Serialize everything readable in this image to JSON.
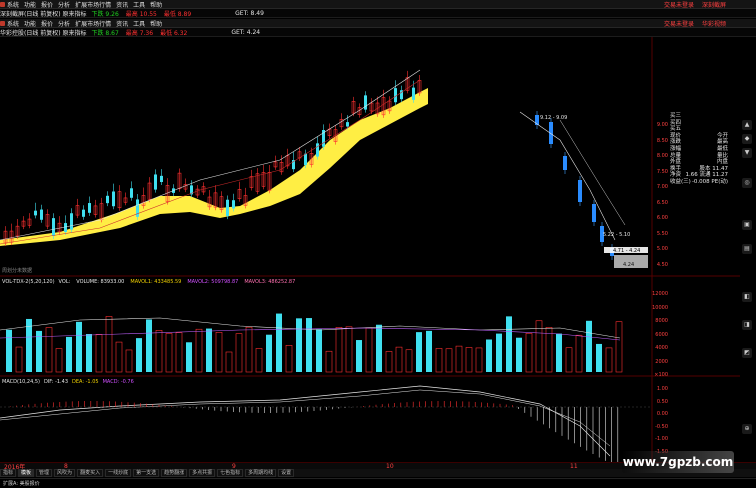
{
  "menu1": {
    "items": [
      "系统",
      "功能",
      "报价",
      "分析",
      "扩展市场行情",
      "资讯",
      "工具",
      "帮助"
    ],
    "right_links": [
      "交易未登录",
      "深刻截屏"
    ]
  },
  "info1": {
    "name": "深刻截屏(日线 前复权) 原来指标",
    "tags": [
      "下跌 9.26",
      "最高 10.55",
      "最低 8.89"
    ],
    "get": "GET: 8.49"
  },
  "menu2": {
    "items": [
      "系统",
      "功能",
      "报价",
      "分析",
      "扩展市场行情",
      "资讯",
      "工具",
      "帮助"
    ],
    "right_links": [
      "交易未登录",
      "华彩视频"
    ]
  },
  "info2": {
    "name": "华彩控股(日线 前复权) 原来指标",
    "tags": [
      "下跌 8.67",
      "最高 7.36",
      "最低 6.32"
    ],
    "get": "GET: 4.24"
  },
  "price_axis": [
    "9.00",
    "8.50",
    "8.00",
    "7.50",
    "7.00",
    "6.50",
    "6.00",
    "5.50",
    "5.00",
    "4.50"
  ],
  "quote_panel": [
    {
      "label": "买三",
      "value": ""
    },
    {
      "label": "买四",
      "value": ""
    },
    {
      "label": "买五",
      "value": ""
    },
    {
      "label": "现价",
      "value": "今开"
    },
    {
      "label": "涨跌",
      "value": "最高"
    },
    {
      "label": "涨幅",
      "value": "最低"
    },
    {
      "label": "总量",
      "value": "量比"
    },
    {
      "label": "外盘",
      "value": "内盘"
    },
    {
      "label": "换手",
      "value": "股本 11.47"
    },
    {
      "label": "净资",
      "value": "1.66 流通 11.27"
    },
    {
      "label": "收益(三)",
      "value": "-0.008 PE(动)"
    }
  ],
  "annotations": {
    "high_label": "9.12 - 9.09",
    "low_label1": "5.22 - 5.10",
    "low_label2": "4.71 - 4.24",
    "low_label3": "4.24",
    "no_data": "周划分未数据"
  },
  "volume": {
    "header": "VOL-TDX-2(5,20,120)",
    "volume_label": "VOL:",
    "volume_value": "VOLUME: 83933.00",
    "mavol1": "MAVOL1: 433485.59",
    "mavol2": "MAVOL2: 509798.87",
    "mavol3": "MAVOL3: 486252.87",
    "axis": [
      "12000",
      "10000",
      "8000",
      "6000",
      "4000",
      "2000",
      "×100"
    ]
  },
  "macd": {
    "header": "MACD(10,24,5)",
    "dif": "DIF: -1.43",
    "dea": "DEA: -1.05",
    "macd": "MACD: -0.76",
    "axis": [
      "1.00",
      "0.50",
      "0.00",
      "-0.50",
      "-1.00",
      "-1.50"
    ]
  },
  "time_axis": {
    "start": "2016年",
    "m1": "8",
    "m2": "9",
    "m3": "10",
    "m4": "11"
  },
  "tabs": [
    "指标",
    "模板",
    "管理",
    "风吹为",
    "翻麦买入",
    "一线炒底",
    "第一支选",
    "趋势翻涨",
    "多点共振",
    "七色指标",
    "多周期均线",
    "设置"
  ],
  "status": {
    "left": "扩展A: 美股报价"
  },
  "watermark": "www.7gpzb.com",
  "colors": {
    "up": "#ff3030",
    "down": "#40e0f0",
    "band": "#ffee44",
    "bg": "#000000"
  }
}
